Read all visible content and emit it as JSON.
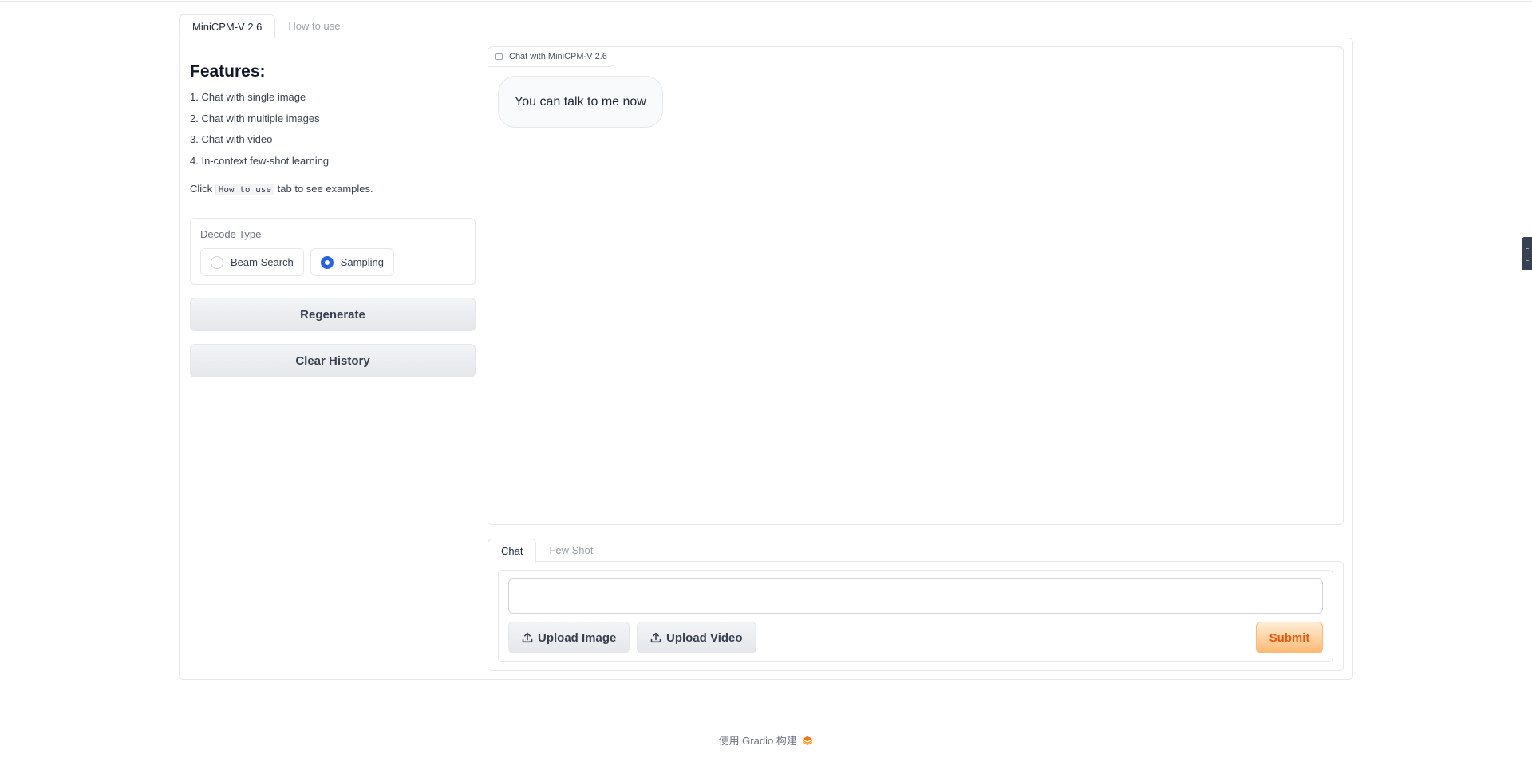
{
  "tabs": {
    "main": [
      {
        "label": "MiniCPM-V 2.6",
        "active": true
      },
      {
        "label": "How to use",
        "active": false
      }
    ]
  },
  "features": {
    "title": "Features:",
    "items": [
      "1. Chat with single image",
      "2. Chat with multiple images",
      "3. Chat with video",
      "4. In-context few-shot learning"
    ],
    "click_prefix": "Click",
    "click_code": "How to use",
    "click_suffix": "tab to see examples."
  },
  "decode": {
    "label": "Decode Type",
    "options": [
      {
        "label": "Beam Search",
        "selected": false
      },
      {
        "label": "Sampling",
        "selected": true
      }
    ]
  },
  "buttons": {
    "regenerate": "Regenerate",
    "clear_history": "Clear History"
  },
  "chat": {
    "label": "Chat with MiniCPM-V 2.6",
    "messages": [
      "You can talk to me now"
    ]
  },
  "input_tabs": [
    {
      "label": "Chat",
      "active": true
    },
    {
      "label": "Few Shot",
      "active": false
    }
  ],
  "input": {
    "value": "",
    "upload_image": "Upload Image",
    "upload_video": "Upload Video",
    "submit": "Submit"
  },
  "footer": {
    "text": "使用 Gradio 构建"
  },
  "colors": {
    "accent": "#2563eb",
    "submit_text": "#ea580c",
    "submit_bg": "#fdba74",
    "border": "#e5e7eb"
  },
  "icons": [
    "chat-icon",
    "upload-icon",
    "gradio-logo-icon"
  ]
}
